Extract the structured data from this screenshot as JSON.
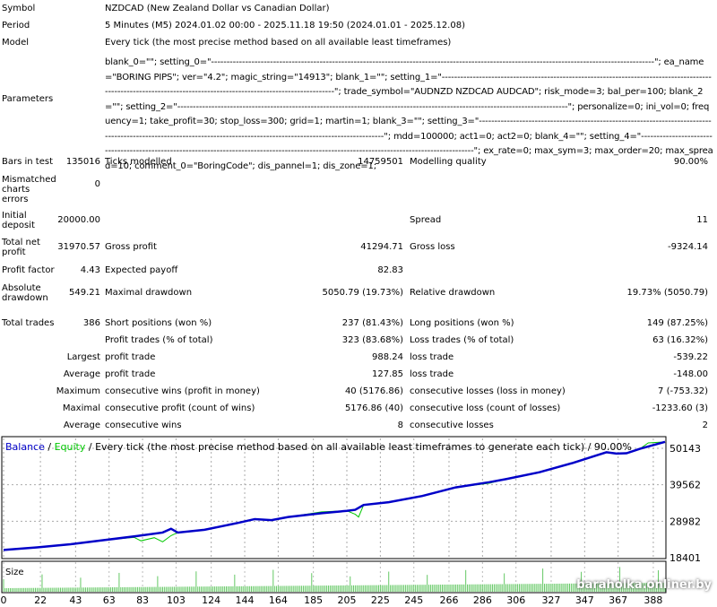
{
  "report": {
    "symbol": {
      "label": "Symbol",
      "value": "NZDCAD (New Zealand Dollar vs Canadian Dollar)"
    },
    "period": {
      "label": "Period",
      "value": "5 Minutes (M5) 2024.01.02 00:00 - 2025.11.18 19:50 (2024.01.01 - 2025.12.08)"
    },
    "model": {
      "label": "Model",
      "value": "Every tick (the most precise method based on all available least timeframes)"
    },
    "parameters": {
      "label": "Parameters",
      "value": "blank_0=\"\"; setting_0=\"-----------------------------------------------------------------------------------------------------------------------------------------------\"; ea_name=\"BORING PIPS\"; ver=\"4.2\"; magic_string=\"14913\"; blank_1=\"\"; setting_1=\"-----------------------------------------------------------------------------------------------------------------------------------------------------------------\"; trade_symbol=\"AUDNZD NZDCAD AUDCAD\"; risk_mode=3; bal_per=100; blank_2=\"\"; setting_2=\"------------------------------------------------------------------------------------------------------------------------------\"; personalize=0; ini_vol=0; frequency=1; take_profit=30; stop_loss=300; grid=1; martin=1; blank_3=\"\"; setting_3=\"---------------------------------------------------------------------------------------------------------------------------------------------------------------------\"; mdd=100000; act1=0; act2=0; blank_4=\"\"; setting_4=\"----------------------------------------------------------------------------------------------------------------------------------------------\"; ex_rate=0; max_sym=3; max_order=20; max_spread=10; comment_0=\"BoringCode\"; dis_pannel=1; dis_zone=1;"
    },
    "bars_in_test": {
      "label": "Bars in test",
      "value": "135016"
    },
    "ticks_modelled": {
      "label": "Ticks modelled",
      "value": "14759501"
    },
    "modelling_quality": {
      "label": "Modelling quality",
      "value": "90.00%"
    },
    "mismatched": {
      "label": "Mismatched charts errors",
      "value": "0"
    },
    "initial_deposit": {
      "label": "Initial deposit",
      "value": "20000.00"
    },
    "spread": {
      "label": "Spread",
      "value": "11"
    },
    "total_net_profit": {
      "label": "Total net profit",
      "value": "31970.57"
    },
    "gross_profit": {
      "label": "Gross profit",
      "value": "41294.71"
    },
    "gross_loss": {
      "label": "Gross loss",
      "value": "-9324.14"
    },
    "profit_factor": {
      "label": "Profit factor",
      "value": "4.43"
    },
    "expected_payoff": {
      "label": "Expected payoff",
      "value": "82.83"
    },
    "absolute_drawdown": {
      "label": "Absolute drawdown",
      "value": "549.21"
    },
    "maximal_drawdown": {
      "label": "Maximal drawdown",
      "value": "5050.79 (19.73%)"
    },
    "relative_drawdown": {
      "label": "Relative drawdown",
      "value": "19.73% (5050.79)"
    },
    "total_trades": {
      "label": "Total trades",
      "value": "386"
    },
    "short_positions": {
      "label": "Short positions (won %)",
      "value": "237 (81.43%)"
    },
    "long_positions": {
      "label": "Long positions (won %)",
      "value": "149 (87.25%)"
    },
    "profit_trades": {
      "label": "Profit trades (% of total)",
      "value": "323 (83.68%)"
    },
    "loss_trades": {
      "label": "Loss trades (% of total)",
      "value": "63 (16.32%)"
    },
    "largest": {
      "label": "Largest",
      "profit_label": "profit trade",
      "profit": "988.24",
      "loss_label": "loss trade",
      "loss": "-539.22"
    },
    "average": {
      "label": "Average",
      "profit_label": "profit trade",
      "profit": "127.85",
      "loss_label": "loss trade",
      "loss": "-148.00"
    },
    "maximum": {
      "label": "Maximum",
      "profit_label": "consecutive wins (profit in money)",
      "profit": "40 (5176.86)",
      "loss_label": "consecutive losses (loss in money)",
      "loss": "7 (-753.32)"
    },
    "maximal": {
      "label": "Maximal",
      "profit_label": "consecutive profit (count of wins)",
      "profit": "5176.86 (40)",
      "loss_label": "consecutive loss (count of losses)",
      "loss": "-1233.60 (3)"
    },
    "average2": {
      "label": "Average",
      "profit_label": "consecutive wins",
      "profit": "8",
      "loss_label": "consecutive losses",
      "loss": "2"
    }
  },
  "chart_data": {
    "type": "line",
    "title_balance": "Balance",
    "title_sep1": " / ",
    "title_equity": "Equity",
    "title_rest": " / Every tick (the most precise method based on all available least timeframes to generate each tick) / 90.00%",
    "size_label": "Size",
    "y_ticks": [
      50143,
      39562,
      28982,
      18401
    ],
    "ylim": [
      18401,
      53000
    ],
    "xlim": [
      0,
      395
    ],
    "x_ticks": [
      0,
      22,
      43,
      63,
      83,
      103,
      124,
      144,
      164,
      185,
      205,
      225,
      245,
      266,
      286,
      306,
      327,
      347,
      367,
      388
    ],
    "series": [
      {
        "name": "Balance",
        "color": "#0000c8",
        "x": [
          0,
          20,
          40,
          60,
          80,
          95,
          100,
          104,
          120,
          140,
          150,
          160,
          170,
          190,
          205,
          210,
          215,
          230,
          250,
          270,
          290,
          300,
          320,
          340,
          360,
          366,
          372,
          380,
          395
        ],
        "y": [
          20650,
          21400,
          22300,
          23500,
          24700,
          25700,
          26800,
          25700,
          26500,
          28500,
          29600,
          29300,
          30200,
          31300,
          32000,
          32300,
          33700,
          34500,
          36300,
          38800,
          40300,
          41200,
          43200,
          45900,
          49000,
          48600,
          48700,
          50000,
          52000
        ]
      },
      {
        "name": "Equity",
        "color": "#00c800",
        "x": [
          0,
          20,
          40,
          60,
          78,
          82,
          90,
          95,
          100,
          104,
          120,
          140,
          150,
          160,
          170,
          190,
          205,
          210,
          212,
          215,
          230,
          250,
          270,
          290,
          300,
          320,
          340,
          360,
          366,
          372,
          380,
          385,
          395
        ],
        "y": [
          20650,
          21400,
          22300,
          23500,
          24300,
          23300,
          24200,
          23000,
          24800,
          25700,
          26500,
          28500,
          29600,
          29300,
          30200,
          31700,
          32000,
          31000,
          30200,
          33700,
          34500,
          36300,
          38800,
          40000,
          41200,
          43200,
          45900,
          49000,
          48600,
          48700,
          50000,
          51700,
          52000
        ]
      }
    ],
    "colors": {
      "balance": "#0000c8",
      "equity": "#00c800",
      "size": "#64c864"
    }
  },
  "watermark": "baraholka.onliner.by"
}
